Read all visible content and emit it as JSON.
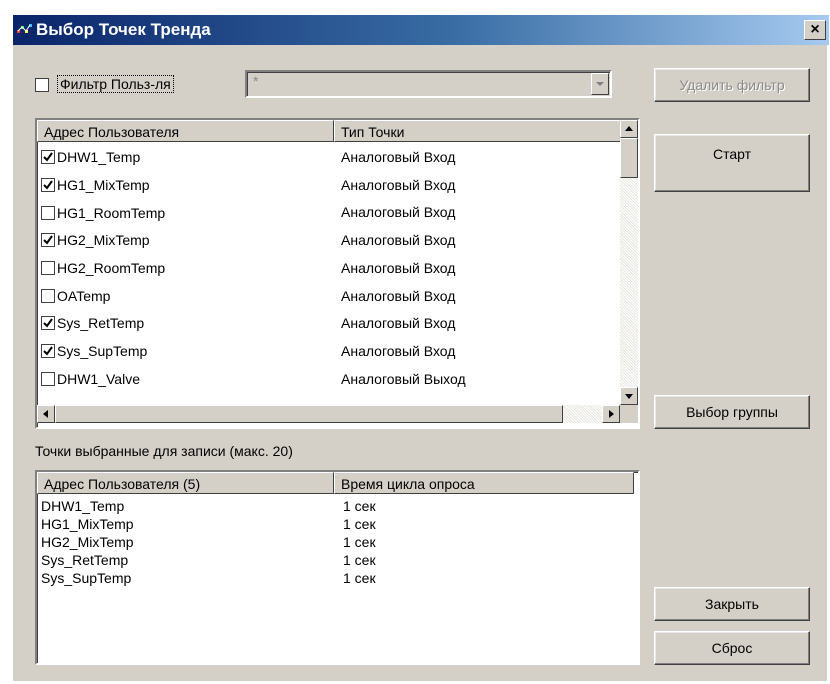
{
  "window": {
    "title": "Выбор Точек Тренда",
    "close_glyph": "×"
  },
  "filter": {
    "checkbox_label": "Фильтр Польз-ля",
    "checked": false,
    "value": "*",
    "delete_button": "Удалить фильтр"
  },
  "points_list": {
    "headers": [
      "Адрес Пользователя",
      "Тип Точки"
    ],
    "rows": [
      {
        "name": "DHW1_Temp",
        "type": "Аналоговый Вход",
        "checked": true
      },
      {
        "name": "HG1_MixTemp",
        "type": "Аналоговый Вход",
        "checked": true
      },
      {
        "name": "HG1_RoomTemp",
        "type": "Аналоговый Вход",
        "checked": false
      },
      {
        "name": "HG2_MixTemp",
        "type": "Аналоговый Вход",
        "checked": true
      },
      {
        "name": "HG2_RoomTemp",
        "type": "Аналоговый Вход",
        "checked": false
      },
      {
        "name": "OATemp",
        "type": "Аналоговый Вход",
        "checked": false
      },
      {
        "name": "Sys_RetTemp",
        "type": "Аналоговый Вход",
        "checked": true
      },
      {
        "name": "Sys_SupTemp",
        "type": "Аналоговый Вход",
        "checked": true
      },
      {
        "name": "DHW1_Valve",
        "type": "Аналоговый Выход",
        "checked": false
      }
    ]
  },
  "selected": {
    "caption": "Точки выбранные для записи (макс. 20)",
    "headers": [
      "Адрес Пользователя (5)",
      "Время цикла опроса"
    ],
    "rows": [
      {
        "name": "DHW1_Temp",
        "cycle": "1 сек"
      },
      {
        "name": "HG1_MixTemp",
        "cycle": "1 сек"
      },
      {
        "name": "HG2_MixTemp",
        "cycle": "1 сек"
      },
      {
        "name": "Sys_RetTemp",
        "cycle": "1 сек"
      },
      {
        "name": "Sys_SupTemp",
        "cycle": "1 сек"
      }
    ]
  },
  "buttons": {
    "start": "Старт",
    "group": "Выбор группы",
    "close": "Закрыть",
    "reset": "Сброс"
  }
}
